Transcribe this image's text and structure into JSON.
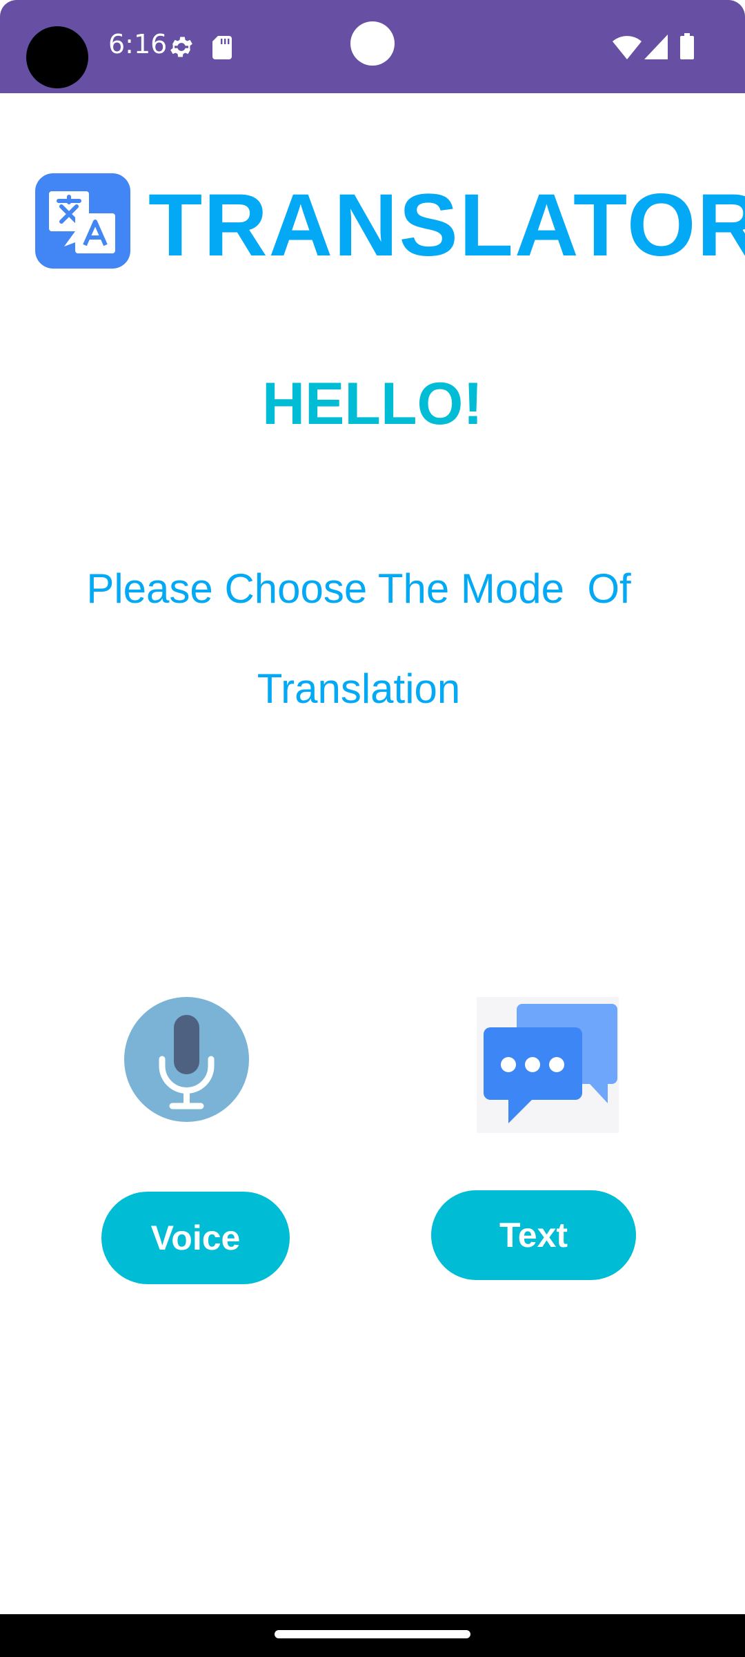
{
  "status_bar": {
    "time": "6:16",
    "icons": [
      "settings-gear-icon",
      "sd-card-icon",
      "wifi-icon",
      "cellular-signal-icon",
      "battery-icon"
    ],
    "background_color": "#6750a4"
  },
  "header": {
    "logo_icon": "translate-icon",
    "logo_color": "#4285f4",
    "title": "TRANSLATOR",
    "title_color": "#03a9f4"
  },
  "main": {
    "greeting": "HELLO!",
    "greeting_color": "#00bcd4",
    "instruction": "Please Choose The Mode  Of\nTranslation",
    "instruction_color": "#03a9f4"
  },
  "modes": {
    "voice": {
      "icon": "microphone-icon",
      "button_label": "Voice"
    },
    "text": {
      "icon": "chat-bubbles-icon",
      "button_label": "Text"
    },
    "button_color": "#00bcd4"
  }
}
